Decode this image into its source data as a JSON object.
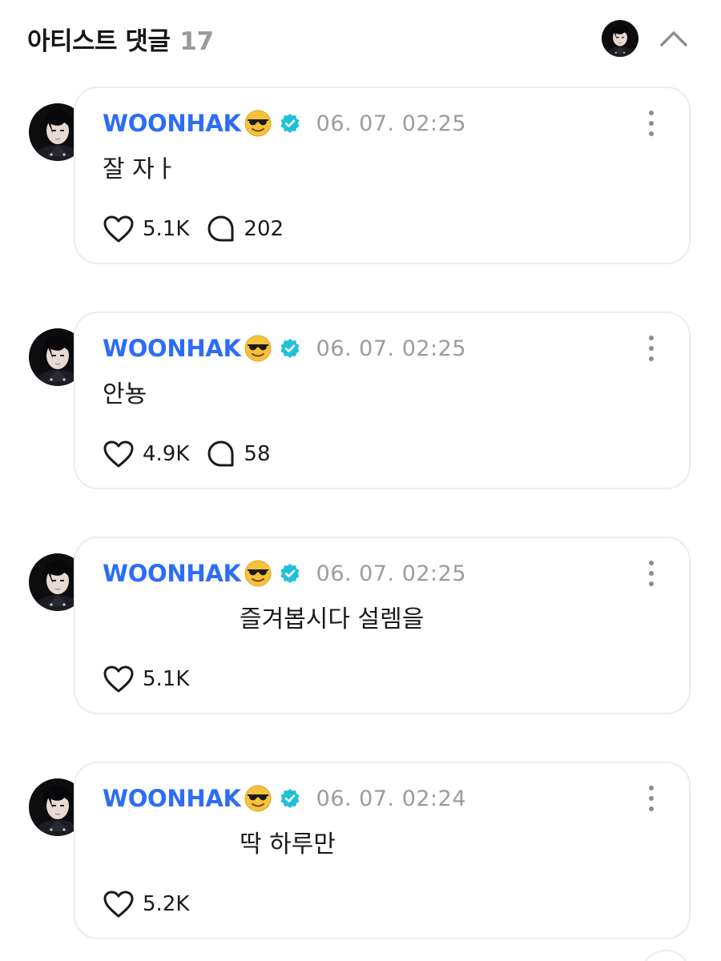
{
  "header": {
    "title": "아티스트 댓글",
    "count": "17",
    "avatar_icon": "artist-avatar",
    "collapse_icon": "chevron-up-icon"
  },
  "colors": {
    "author": "#2d6df5",
    "verified": "#1fc1d9",
    "muted": "#9c9c9c",
    "border": "#ececec"
  },
  "comments": [
    {
      "author": "WOONHAK",
      "emoji": "😎",
      "timestamp": "06. 07. 02:25",
      "text": "잘 자ㅏ",
      "likes": "5.1K",
      "replies": "202"
    },
    {
      "author": "WOONHAK",
      "emoji": "😎",
      "timestamp": "06. 07. 02:25",
      "text": "안뇽",
      "likes": "4.9K",
      "replies": "58"
    },
    {
      "author": "WOONHAK",
      "emoji": "😎",
      "timestamp": "06. 07. 02:25",
      "text": "즐겨봅시다 설렘을",
      "likes": "5.1K"
    },
    {
      "author": "WOONHAK",
      "emoji": "😎",
      "timestamp": "06. 07. 02:24",
      "text": "딱 하루만",
      "likes": "5.2K"
    }
  ]
}
